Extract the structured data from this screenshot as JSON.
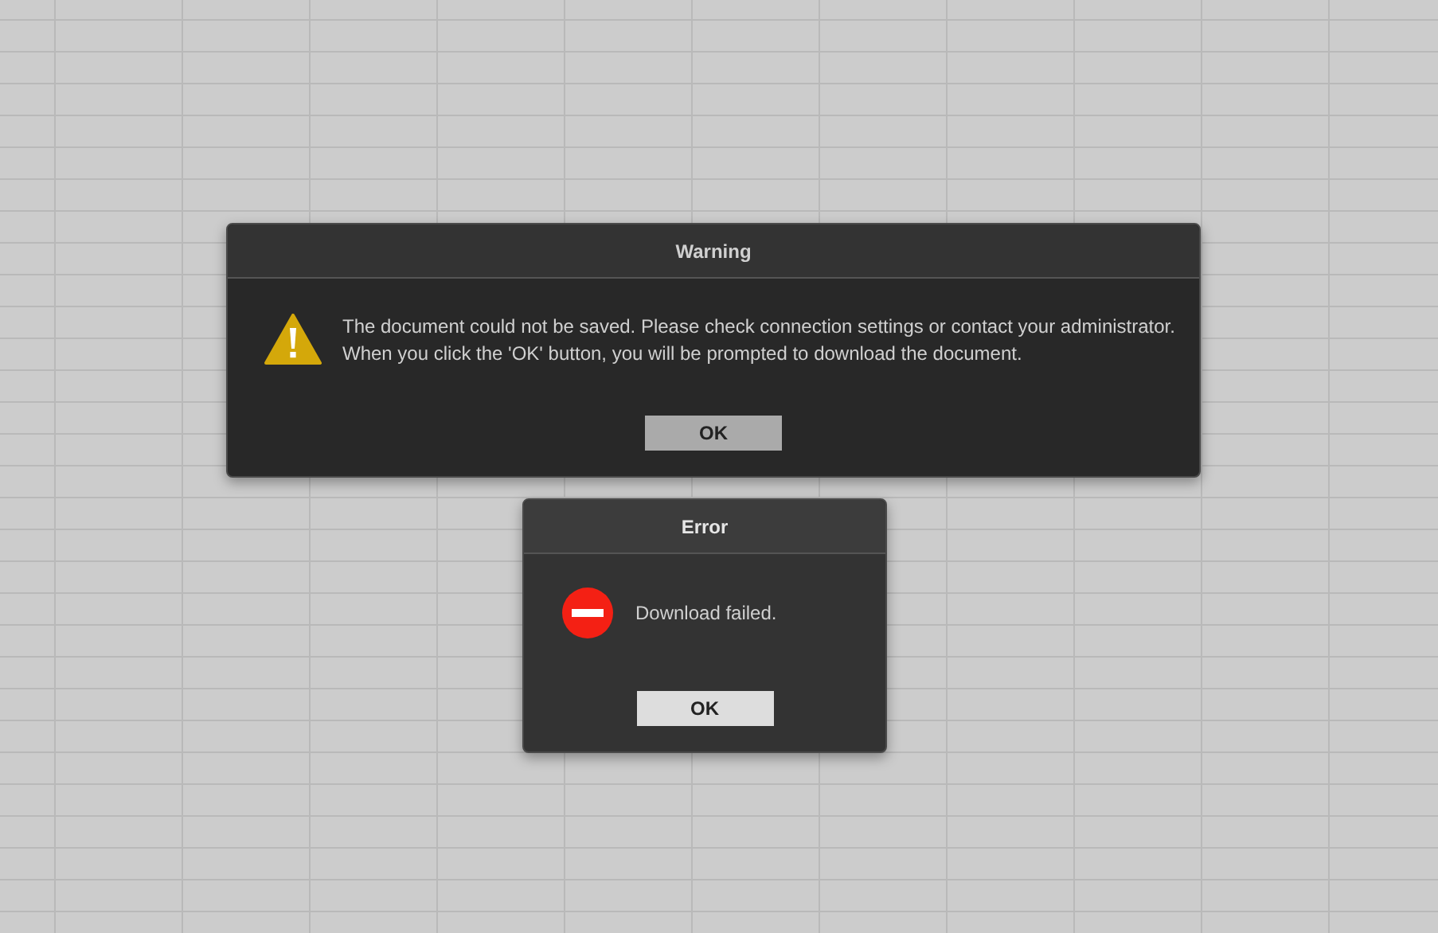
{
  "dialogs": [
    {
      "kind": "warning",
      "active": false,
      "title": "Warning",
      "message": [
        "The document could not be saved. Please check connection settings or contact your administrator.",
        "When you click the 'OK' button, you will be prompted to download the document."
      ],
      "button": "OK"
    },
    {
      "kind": "error",
      "active": true,
      "title": "Error",
      "message": [
        "Download failed."
      ],
      "button": "OK"
    }
  ]
}
